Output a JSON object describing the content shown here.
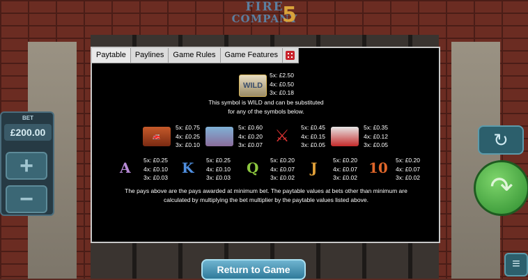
{
  "game": {
    "title_line1": "FIRE",
    "title_line2": "COMPANY",
    "title_number": "5"
  },
  "bet": {
    "label": "BET",
    "value": "£200.00",
    "plus": "+",
    "minus": "−"
  },
  "controls": {
    "refresh_icon": "refresh-icon",
    "spin_icon": "spin-arrow-icon",
    "menu_icon": "hamburger-icon"
  },
  "tabs": [
    {
      "label": "Paytable"
    },
    {
      "label": "Paylines"
    },
    {
      "label": "Game Rules"
    },
    {
      "label": "Game Features"
    }
  ],
  "wild": {
    "symbol_label": "WILD",
    "pays": [
      "5x: £2.50",
      "4x: £0.50",
      "3x: £0.18"
    ],
    "description_line1": "This symbol is WILD and can be substituted",
    "description_line2": "for any of the symbols below."
  },
  "high_symbols": [
    {
      "icon": "fireman-icon",
      "pays": [
        "5x: £0.75",
        "4x: £0.25",
        "3x: £0.10"
      ]
    },
    {
      "icon": "woman-icon",
      "pays": [
        "5x: £0.60",
        "4x: £0.20",
        "3x: £0.07"
      ]
    },
    {
      "icon": "crossed-axes-icon",
      "pays": [
        "5x: £0.45",
        "4x: £0.15",
        "3x: £0.05"
      ]
    },
    {
      "icon": "fire-truck-icon",
      "pays": [
        "5x: £0.35",
        "4x: £0.12",
        "3x: £0.05"
      ]
    }
  ],
  "low_symbols": [
    {
      "letter": "A",
      "color": "#b78ad6",
      "pays": [
        "5x: £0.25",
        "4x: £0.10",
        "3x: £0.03"
      ]
    },
    {
      "letter": "K",
      "color": "#4f8fe0",
      "pays": [
        "5x: £0.25",
        "4x: £0.10",
        "3x: £0.03"
      ]
    },
    {
      "letter": "Q",
      "color": "#8cc63f",
      "pays": [
        "5x: £0.20",
        "4x: £0.07",
        "3x: £0.02"
      ]
    },
    {
      "letter": "J",
      "color": "#e3a23a",
      "pays": [
        "5x: £0.20",
        "4x: £0.07",
        "3x: £0.02"
      ]
    },
    {
      "letter": "10",
      "color": "#e0662a",
      "pays": [
        "5x: £0.20",
        "4x: £0.07",
        "3x: £0.02"
      ]
    }
  ],
  "footnote_line1": "The pays above are the pays awarded at minimum bet. The paytable values at bets other than minimum are",
  "footnote_line2": "calculated by multiplying the bet multiplier by the paytable values listed above.",
  "return_button": "Return to Game"
}
